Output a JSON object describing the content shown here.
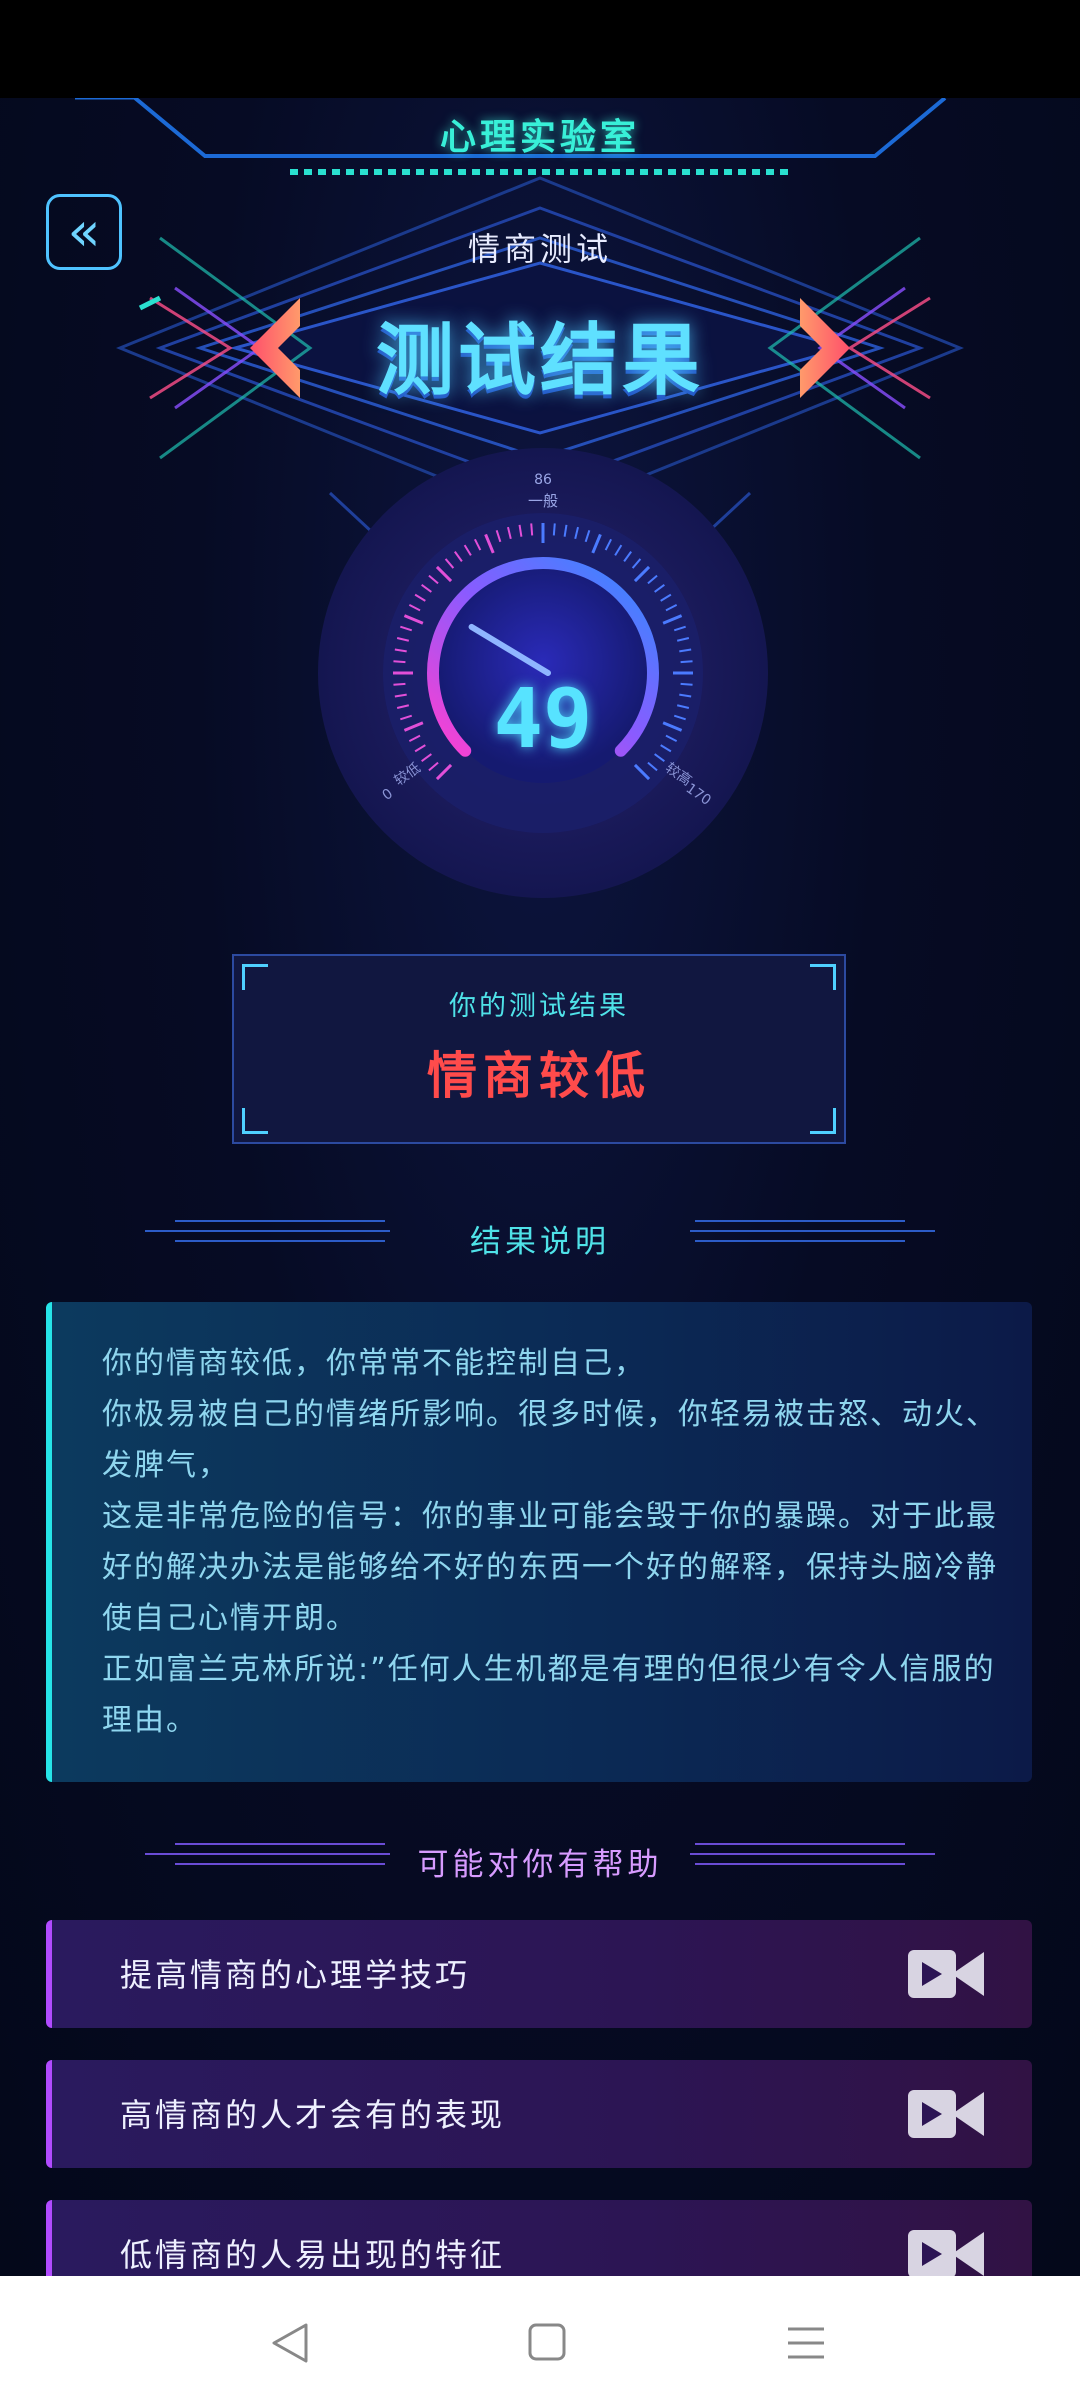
{
  "app": {
    "title": "心理实验室",
    "subtitle": "情商测试",
    "heading": "测试结果"
  },
  "gauge": {
    "score": "49",
    "score_value": 49,
    "min_label": "0",
    "min_text": "较低",
    "mid_value": "86",
    "mid_text": "一般",
    "max_label": "170",
    "max_text": "较高",
    "range": [
      0,
      170
    ]
  },
  "result": {
    "label": "你的测试结果",
    "value": "情商较低"
  },
  "explanation": {
    "heading": "结果说明",
    "paragraphs": [
      "你的情商较低，你常常不能控制自己，",
      "你极易被自己的情绪所影响。很多时候，你轻易被击怒、动火、发脾气，",
      "这是非常危险的信号：你的事业可能会毁于你的暴躁。对于此最好的解决办法是能够给不好的东西一个好的解释，保持头脑冷静使自己心情开朗。",
      "正如富兰克林所说:”任何人生机都是有理的但很少有令人信服的理由。"
    ]
  },
  "help": {
    "heading": "可能对你有帮助",
    "items": [
      {
        "label": "提高情商的心理学技巧",
        "icon": "video-camera-icon"
      },
      {
        "label": "高情商的人才会有的表现",
        "icon": "video-camera-icon"
      },
      {
        "label": "低情商的人易出现的特征",
        "icon": "video-camera-icon"
      }
    ]
  },
  "colors": {
    "accent_cyan": "#38f0d8",
    "result_red": "#ff4b4b",
    "card_border": "#26e4e8",
    "help_border": "#b14bff"
  }
}
